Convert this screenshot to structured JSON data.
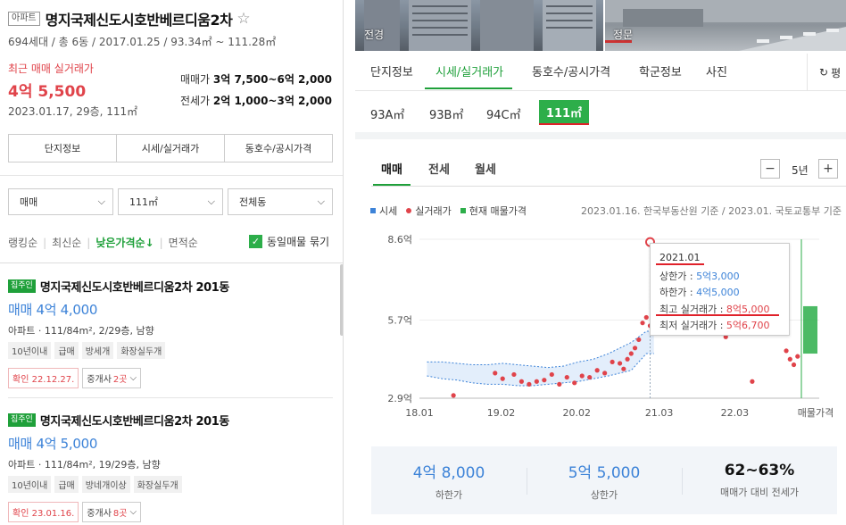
{
  "left": {
    "type_badge": "아파트",
    "complex_name": "명지국제신도시호반베르디움2차",
    "star": "☆",
    "info": "694세대 / 총 6동 / 2017.01.25 / 93.34㎡ ~ 111.28㎡",
    "recent_label": "최근 매매 실거래가",
    "recent_price": "4억 5,500",
    "recent_date": "2023.01.17, 29층, 111㎡",
    "sale_range_label": "매매가",
    "sale_range_value": "3억 7,500~6억 2,000",
    "jeonse_range_label": "전세가",
    "jeonse_range_value": "2억 1,000~3억 2,000",
    "buttons": [
      "단지정보",
      "시세/실거래가",
      "동호수/공시가격"
    ],
    "filters": [
      "매매",
      "111㎡",
      "전체동"
    ],
    "sort": [
      "랭킹순",
      "최신순",
      "낮은가격순↓",
      "면적순"
    ],
    "same_listing_label": "동일매물 묶기",
    "listings": [
      {
        "badge": "집주인",
        "name": "명지국제신도시호반베르디움2차 201동",
        "price": "매매 4억 4,000",
        "desc": "아파트 · 111/84m², 2/29층, 남향",
        "tags": [
          "10년이내",
          "급매",
          "방세개",
          "화장실두개"
        ],
        "confirm": "확인 22.12.27.",
        "broker_label": "중개사",
        "broker_count": "2곳"
      },
      {
        "badge": "집주인",
        "name": "명지국제신도시호반베르디움2차 201동",
        "price": "매매 4억 5,000",
        "desc": "아파트 · 111/84m², 19/29층, 남향",
        "tags": [
          "10년이내",
          "급매",
          "방네개이상",
          "화장실두개"
        ],
        "confirm": "확인 23.01.16.",
        "broker_label": "중개사",
        "broker_count": "8곳"
      }
    ]
  },
  "right": {
    "photo_labels": [
      "전경",
      "정문"
    ],
    "tabs": [
      "단지정보",
      "시세/실거래가",
      "동호수/공시가격",
      "학군정보",
      "사진"
    ],
    "refresh_label": "평",
    "areas": [
      "93A㎡",
      "93B㎡",
      "94C㎡",
      "111㎡"
    ],
    "deal_tabs": [
      "매매",
      "전세",
      "월세"
    ],
    "year_label": "5년",
    "minus": "−",
    "plus": "+",
    "legend": [
      "시세",
      "실거래가",
      "현재 매물가격"
    ],
    "source": "2023.01.16. 한국부동산원 기준 / 2023.01. 국토교통부 기준",
    "tooltip": {
      "date": "2021.01",
      "upper": "상한가 : 5억3,000",
      "lower": "하한가 : 4억5,000",
      "max": "최고 실거래가 : 8억5,000",
      "min": "최저 실거래가 : 5억6,700"
    },
    "summary": [
      {
        "value": "4억 8,000",
        "label": "하한가"
      },
      {
        "value": "5억 5,000",
        "label": "상한가"
      },
      {
        "value": "62~63%",
        "label": "매매가 대비 전세가"
      }
    ]
  },
  "colors": {
    "green": "#2dae4a",
    "red": "#e0434a",
    "blue": "#3d83d8"
  },
  "chart_data": {
    "type": "scatter",
    "y_ticks": [
      "8.6억",
      "5.7억",
      "2.9억"
    ],
    "y_tick_values": [
      8.6,
      5.7,
      2.9
    ],
    "x_ticks": [
      "18.01",
      "19.02",
      "20.02",
      "21.03",
      "22.03",
      "매물가격"
    ],
    "x_tick_values": [
      2018.0,
      2019.08,
      2020.08,
      2021.17,
      2022.17
    ],
    "ylim": [
      2.9,
      8.6
    ],
    "xlim": [
      2018.0,
      2023.05
    ],
    "series": [
      {
        "name": "시세",
        "color": "#3d83d8",
        "x": [
          2018.1,
          2018.3,
          2018.5,
          2018.7,
          2018.9,
          2019.1,
          2019.3,
          2019.5,
          2019.7,
          2019.9,
          2020.1,
          2020.3,
          2020.5,
          2020.65,
          2020.8,
          2021.0,
          2021.1
        ],
        "upper": [
          4.2,
          4.2,
          4.15,
          4.1,
          4.1,
          4.15,
          4.1,
          4.05,
          4.0,
          4.05,
          4.2,
          4.3,
          4.5,
          4.7,
          4.9,
          5.3,
          5.3
        ],
        "lower": [
          3.7,
          3.6,
          3.55,
          3.45,
          3.4,
          3.4,
          3.35,
          3.35,
          3.4,
          3.45,
          3.5,
          3.6,
          3.7,
          3.8,
          3.9,
          4.5,
          4.5
        ]
      },
      {
        "name": "실거래가",
        "color": "#e0434a",
        "x": [
          2018.45,
          2019.0,
          2019.1,
          2019.25,
          2019.35,
          2019.45,
          2019.55,
          2019.65,
          2019.75,
          2019.85,
          2019.95,
          2020.05,
          2020.15,
          2020.25,
          2020.35,
          2020.45,
          2020.55,
          2020.65,
          2020.7,
          2020.75,
          2020.8,
          2020.85,
          2020.9,
          2020.95,
          2021.0,
          2021.05,
          2022.05,
          2022.4,
          2022.85,
          2022.9,
          2022.95,
          2023.0
        ],
        "y": [
          3.0,
          3.8,
          3.6,
          3.75,
          3.5,
          3.4,
          3.5,
          3.55,
          3.75,
          3.4,
          3.65,
          3.45,
          3.7,
          3.65,
          3.9,
          3.8,
          4.2,
          4.15,
          3.95,
          4.3,
          4.5,
          4.7,
          5.0,
          5.6,
          5.8,
          5.5,
          5.1,
          3.5,
          4.6,
          4.3,
          4.1,
          4.4
        ]
      },
      {
        "name": "현재 매물가격",
        "color": "#2dae4a",
        "low": 4.5,
        "high": 6.2
      }
    ],
    "highlight": {
      "x": 2021.05,
      "y": 8.5
    }
  }
}
